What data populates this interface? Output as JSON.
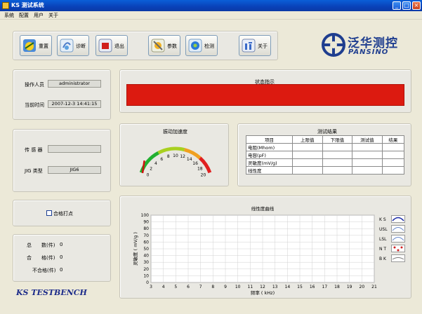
{
  "window": {
    "title": "KS 测试系统",
    "min_glyph": "_",
    "max_glyph": "□",
    "close_glyph": "×"
  },
  "menu": [
    "系统",
    "配置",
    "用户",
    "关于"
  ],
  "toolbar": [
    {
      "label": "重置",
      "icon": "reset-icon"
    },
    {
      "label": "诊断",
      "icon": "diagnose-icon"
    },
    {
      "label": "退出",
      "icon": "exit-icon"
    },
    {
      "label": "参数",
      "icon": "params-icon"
    },
    {
      "label": "检测",
      "icon": "detect-icon"
    },
    {
      "label": "关于",
      "icon": "about-icon"
    }
  ],
  "logo": {
    "cn": "泛华测控",
    "en": "PANSINO"
  },
  "operator": {
    "label": "操作人员",
    "value": "administrator"
  },
  "datetime": {
    "label": "当前时间",
    "value": "2007-12-3 14:41:15"
  },
  "sensor": {
    "label": "传 感 器",
    "value": ""
  },
  "jig": {
    "label": "JIG 类型",
    "value": "JIG6"
  },
  "status": {
    "title": "状态指示",
    "color": "#dc1a10"
  },
  "gauge": {
    "title": "振动加速度",
    "min": 0,
    "max": 20,
    "value": 0,
    "ticks": [
      "0",
      "2",
      "4",
      "6",
      "8",
      "10",
      "12",
      "14",
      "16",
      "18",
      "20"
    ]
  },
  "results": {
    "title": "测试结果",
    "headers": [
      "项目",
      "上限值",
      "下限值",
      "测试值",
      "结果"
    ],
    "rows": [
      [
        "电阻(Mhom)",
        "",
        "",
        "",
        ""
      ],
      [
        "电容(pF)",
        "",
        "",
        "",
        ""
      ],
      [
        "灵敏度(mV/g)",
        "",
        "",
        "",
        ""
      ],
      [
        "线性度",
        "",
        "",
        "",
        ""
      ]
    ]
  },
  "mark_option": {
    "label": "合格打点",
    "checked": false
  },
  "counts": [
    {
      "label": "总　　数(件)",
      "value": "0"
    },
    {
      "label": "合　　格(件)",
      "value": "0"
    },
    {
      "label": "不合格(件)",
      "value": "0"
    }
  ],
  "bench_label": "KS TESTBENCH",
  "chart_data": {
    "type": "line",
    "title": "线性度曲线",
    "xlabel": "频率 ( kHz)",
    "ylabel": "灵敏度 ( mV/g )",
    "xlim": [
      3,
      21
    ],
    "ylim": [
      0,
      100
    ],
    "xticks": [
      "3",
      "4",
      "5",
      "6",
      "7",
      "8",
      "9",
      "10",
      "11",
      "12",
      "13",
      "14",
      "15",
      "16",
      "17",
      "18",
      "19",
      "20",
      "21"
    ],
    "yticks": [
      "0",
      "10",
      "20",
      "30",
      "40",
      "50",
      "60",
      "70",
      "80",
      "90",
      "100"
    ],
    "grid": true,
    "series": [
      {
        "name": "K S",
        "color": "#1a2aa8",
        "values": []
      },
      {
        "name": "USL",
        "color": "#6a8acc",
        "values": []
      },
      {
        "name": "LSL",
        "color": "#6a8acc",
        "values": []
      },
      {
        "name": "N T",
        "color": "#d02020",
        "values": []
      },
      {
        "name": "B K",
        "color": "#7a7a7a",
        "values": []
      }
    ]
  }
}
